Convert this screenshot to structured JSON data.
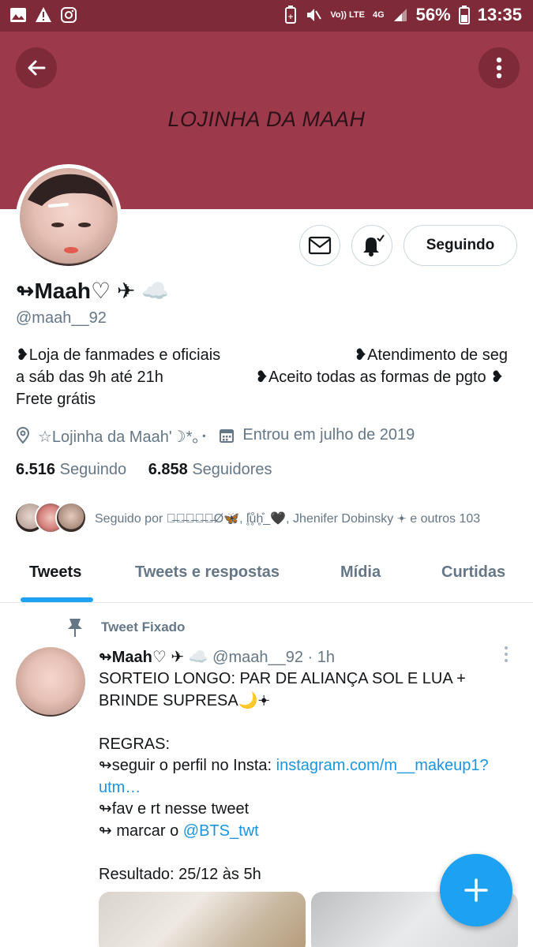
{
  "status_bar": {
    "battery": "56%",
    "time": "13:35",
    "volte": "Vo)) LTE",
    "network": "4G"
  },
  "profile": {
    "banner_title": "LOJINHA DA MAAH",
    "name": "↬Maah♡ ✈ ☁️",
    "handle": "@maah__92",
    "follow_button": "Seguindo",
    "bio": {
      "line1_left": "❥Loja de fanmades e oficiais",
      "line1_right": "❥Atendimento de seg",
      "line2_left": "a sáb das 9h até 21h",
      "line2_right": "❥Aceito todas as formas de pgto ❥",
      "line3": "Frete grátis"
    },
    "location": "☆Lojinha da Maah'☽*｡･",
    "joined": "Entrou em julho de 2019",
    "following_count": "6.516",
    "following_label": "Seguindo",
    "followers_count": "6.858",
    "followers_label": "Seguidores",
    "followed_by": "Seguido por ꉓ̶ꀎ̶ꀤ̶ꈤ̶ꃅ̶Ø🦋, l̥̊ů̥h̥̊_🖤, Jhenifer Dobinsky 𖥔 e outros 103"
  },
  "tabs": [
    {
      "label": "Tweets",
      "active": true
    },
    {
      "label": "Tweets e respostas",
      "active": false
    },
    {
      "label": "Mídia",
      "active": false
    },
    {
      "label": "Curtidas",
      "active": false
    }
  ],
  "pinned_tweet": {
    "pinned_label": "Tweet Fixado",
    "author_name": "↬Maah♡ ✈ ☁️",
    "author_handle": "@maah__92",
    "time": "· 1h",
    "lines": {
      "l1": "SORTEIO LONGO: PAR DE ALIANÇA SOL E LUA +",
      "l2": "BRINDE SUPRESA🌙𖥔",
      "l3": "REGRAS:",
      "l4_prefix": "↬seguir o perfil no Insta: ",
      "l4_link": "instagram.com/m__makeup1?",
      "l5_link": "utm…",
      "l6": "↬fav e rt nesse tweet",
      "l7_prefix": "↬ marcar o ",
      "l7_link": "@BTS_twt",
      "l8": "Resultado: 25/12 às 5h"
    }
  },
  "colors": {
    "banner": "#9c3a4c",
    "status_bar": "#7f2a38",
    "accent": "#1da1f2",
    "link": "#1b95e0"
  },
  "icons": [
    "back-arrow-icon",
    "more-vertical-icon",
    "mail-icon",
    "bell-icon",
    "location-icon",
    "calendar-icon",
    "pin-icon",
    "plus-icon"
  ]
}
